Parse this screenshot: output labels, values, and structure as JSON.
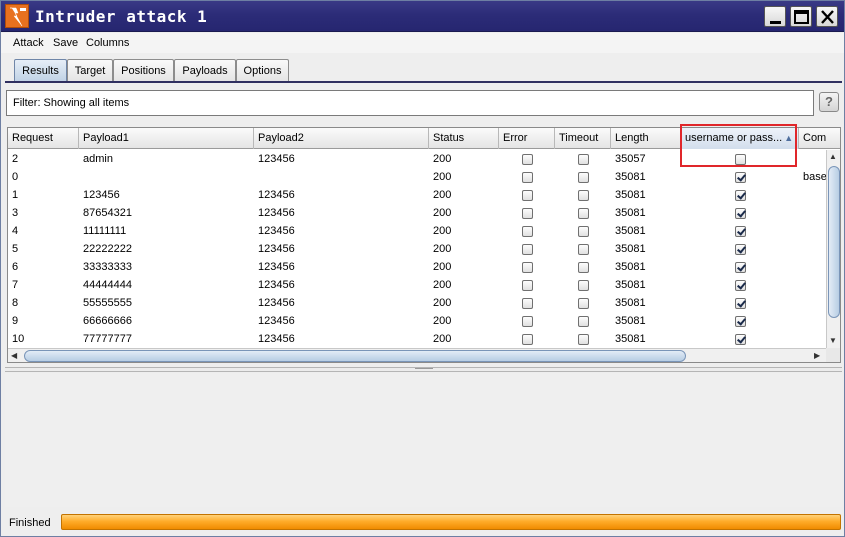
{
  "window": {
    "title": "Intruder attack 1"
  },
  "menu": [
    "Attack",
    "Save",
    "Columns"
  ],
  "tabs": [
    "Results",
    "Target",
    "Positions",
    "Payloads",
    "Options"
  ],
  "active_tab": "Results",
  "filter": {
    "text": "Filter:  Showing all items"
  },
  "help_label": "?",
  "table": {
    "columns": [
      "Request",
      "Payload1",
      "Payload2",
      "Status",
      "Error",
      "Timeout",
      "Length",
      "username or pass...",
      "Com"
    ],
    "sorted_column": "username or pass...",
    "sort_direction": "ascending",
    "rows": [
      {
        "request": "2",
        "payload1": "admin",
        "payload2": "123456",
        "status": "200",
        "error": false,
        "timeout": false,
        "length": "35057",
        "match": false,
        "comment": ""
      },
      {
        "request": "0",
        "payload1": "",
        "payload2": "",
        "status": "200",
        "error": false,
        "timeout": false,
        "length": "35081",
        "match": true,
        "comment": "base"
      },
      {
        "request": "1",
        "payload1": "123456",
        "payload2": "123456",
        "status": "200",
        "error": false,
        "timeout": false,
        "length": "35081",
        "match": true,
        "comment": ""
      },
      {
        "request": "3",
        "payload1": "87654321",
        "payload2": "123456",
        "status": "200",
        "error": false,
        "timeout": false,
        "length": "35081",
        "match": true,
        "comment": ""
      },
      {
        "request": "4",
        "payload1": "11111111",
        "payload2": "123456",
        "status": "200",
        "error": false,
        "timeout": false,
        "length": "35081",
        "match": true,
        "comment": ""
      },
      {
        "request": "5",
        "payload1": "22222222",
        "payload2": "123456",
        "status": "200",
        "error": false,
        "timeout": false,
        "length": "35081",
        "match": true,
        "comment": ""
      },
      {
        "request": "6",
        "payload1": "33333333",
        "payload2": "123456",
        "status": "200",
        "error": false,
        "timeout": false,
        "length": "35081",
        "match": true,
        "comment": ""
      },
      {
        "request": "7",
        "payload1": "44444444",
        "payload2": "123456",
        "status": "200",
        "error": false,
        "timeout": false,
        "length": "35081",
        "match": true,
        "comment": ""
      },
      {
        "request": "8",
        "payload1": "55555555",
        "payload2": "123456",
        "status": "200",
        "error": false,
        "timeout": false,
        "length": "35081",
        "match": true,
        "comment": ""
      },
      {
        "request": "9",
        "payload1": "66666666",
        "payload2": "123456",
        "status": "200",
        "error": false,
        "timeout": false,
        "length": "35081",
        "match": true,
        "comment": ""
      },
      {
        "request": "10",
        "payload1": "77777777",
        "payload2": "123456",
        "status": "200",
        "error": false,
        "timeout": false,
        "length": "35081",
        "match": true,
        "comment": ""
      }
    ]
  },
  "status": {
    "label": "Finished",
    "progress": 1.0
  },
  "colors": {
    "titlebar": "#2c2c78",
    "accent": "#e8711f",
    "progress": "#ffac2a",
    "highlight": "#e0262a"
  }
}
